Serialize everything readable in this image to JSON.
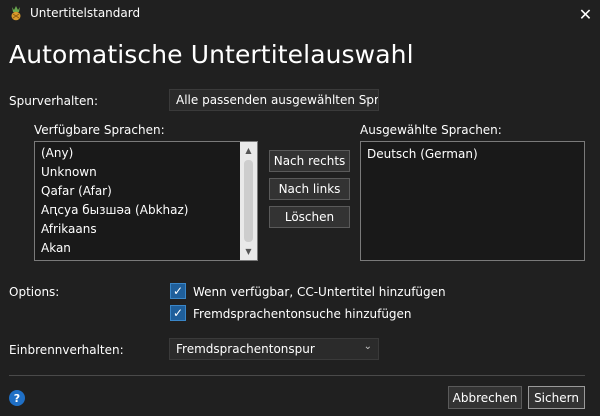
{
  "window": {
    "title": "Untertitelstandard",
    "icon": "handbrake-pineapple-icon",
    "close_symbol": "✕"
  },
  "heading": "Automatische Untertitelauswahl",
  "track_behavior": {
    "label": "Spurverhalten:",
    "value": "Alle passenden ausgewählten Sprachen"
  },
  "available_languages": {
    "label": "Verfügbare Sprachen:",
    "items": [
      "(Any)",
      "Unknown",
      "Qafar (Afar)",
      "Aԥсуа бызшәа (Abkhaz)",
      "Afrikaans",
      "Akan"
    ]
  },
  "buttons": {
    "move_right": "Nach rechts",
    "move_left": "Nach links",
    "clear": "Löschen",
    "cancel": "Abbrechen",
    "save": "Sichern"
  },
  "selected_languages": {
    "label": "Ausgewählte Sprachen:",
    "items": [
      "Deutsch (German)"
    ]
  },
  "options": {
    "label": "Options:",
    "cc_label": "Wenn verfügbar, CC-Untertitel hinzufügen",
    "cc_checked": true,
    "foreign_search_label": "Fremdsprachentonsuche hinzufügen",
    "foreign_search_checked": true
  },
  "burn_in": {
    "label": "Einbrennverhalten:",
    "value": "Fremdsprachentonspur"
  },
  "help_symbol": "?",
  "colors": {
    "background": "#202020",
    "checkbox_accent": "#1f5f9b",
    "help_icon": "#1f6fc5"
  }
}
